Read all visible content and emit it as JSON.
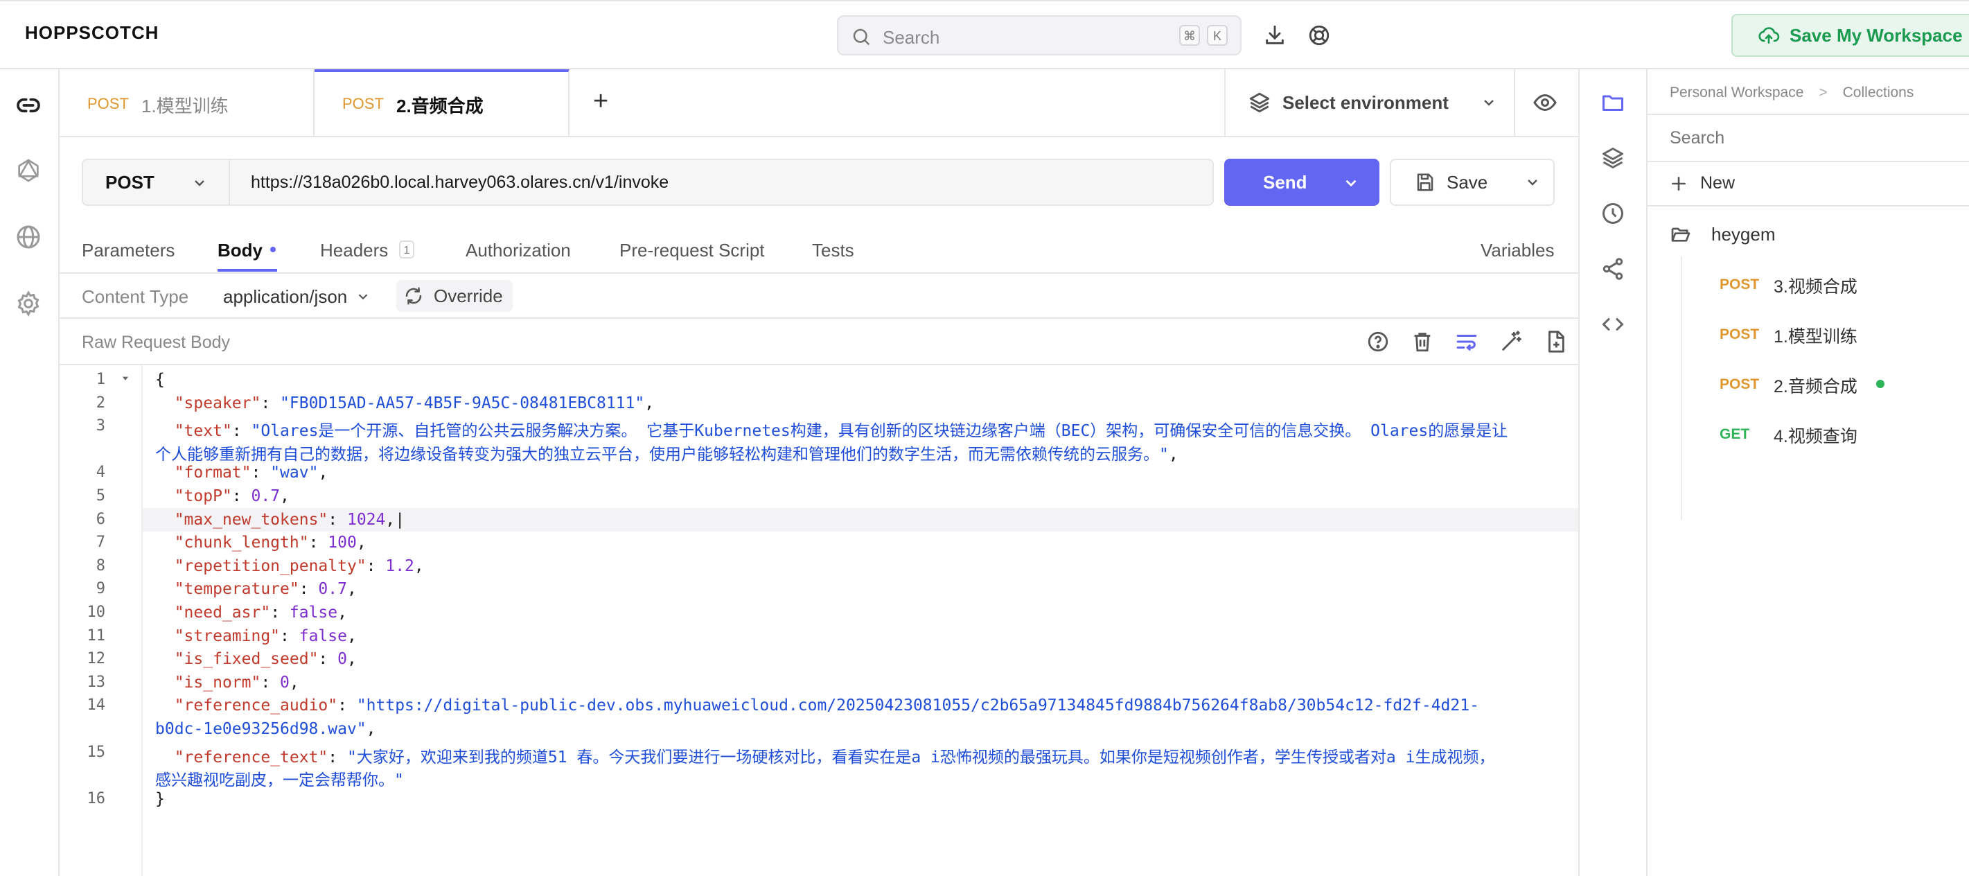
{
  "app": {
    "brand": "HOPPSCOTCH"
  },
  "header": {
    "search_placeholder": "Search",
    "shortcut_key1": "⌘",
    "shortcut_key2": "K",
    "save_workspace_label": "Save My Workspace"
  },
  "tabs": [
    {
      "method": "POST",
      "title": "1.模型训练"
    },
    {
      "method": "POST",
      "title": "2.音频合成"
    }
  ],
  "add_tab_label": "+",
  "environment": {
    "label": "Select environment"
  },
  "request": {
    "method": "POST",
    "url": "https://318a026b0.local.harvey063.olares.cn/v1/invoke",
    "send_label": "Send",
    "save_label": "Save"
  },
  "subtabs": {
    "parameters": "Parameters",
    "body": "Body",
    "headers": "Headers",
    "headers_count": "1",
    "authorization": "Authorization",
    "prerequest": "Pre-request Script",
    "tests": "Tests",
    "variables": "Variables"
  },
  "content_type": {
    "label": "Content Type",
    "value": "application/json",
    "override_label": "Override"
  },
  "raw_body_label": "Raw Request Body",
  "body_lines": [
    {
      "n": "1",
      "parts": [
        [
          "p",
          "{"
        ]
      ]
    },
    {
      "n": "2",
      "parts": [
        [
          "p",
          "  "
        ],
        [
          "k",
          "\"speaker\""
        ],
        [
          "p",
          ": "
        ],
        [
          "s",
          "\"FB0D15AD-AA57-4B5F-9A5C-08481EBC8111\""
        ],
        [
          "p",
          ","
        ]
      ]
    },
    {
      "n": "3",
      "parts": [
        [
          "p",
          "  "
        ],
        [
          "k",
          "\"text\""
        ],
        [
          "p",
          ": "
        ],
        [
          "s",
          "\"Olares是一个开源、自托管的公共云服务解决方案。 它基于Kubernetes构建，具有创新的区块链边缘客户端（BEC）架构，可确保安全可信的信息交换。 Olares的愿景是让"
        ]
      ]
    },
    {
      "n": "",
      "parts": [
        [
          "s",
          "个人能够重新拥有自己的数据，将边缘设备转变为强大的独立云平台，使用户能够轻松构建和管理他们的数字生活，而无需依赖传统的云服务。\""
        ],
        [
          "p",
          ","
        ]
      ]
    },
    {
      "n": "4",
      "parts": [
        [
          "p",
          "  "
        ],
        [
          "k",
          "\"format\""
        ],
        [
          "p",
          ": "
        ],
        [
          "s",
          "\"wav\""
        ],
        [
          "p",
          ","
        ]
      ]
    },
    {
      "n": "5",
      "parts": [
        [
          "p",
          "  "
        ],
        [
          "k",
          "\"topP\""
        ],
        [
          "p",
          ": "
        ],
        [
          "n",
          "0.7"
        ],
        [
          "p",
          ","
        ]
      ]
    },
    {
      "n": "6",
      "parts": [
        [
          "p",
          "  "
        ],
        [
          "k",
          "\"max_new_tokens\""
        ],
        [
          "p",
          ": "
        ],
        [
          "n",
          "1024"
        ],
        [
          "p",
          ",|"
        ]
      ]
    },
    {
      "n": "7",
      "parts": [
        [
          "p",
          "  "
        ],
        [
          "k",
          "\"chunk_length\""
        ],
        [
          "p",
          ": "
        ],
        [
          "n",
          "100"
        ],
        [
          "p",
          ","
        ]
      ]
    },
    {
      "n": "8",
      "parts": [
        [
          "p",
          "  "
        ],
        [
          "k",
          "\"repetition_penalty\""
        ],
        [
          "p",
          ": "
        ],
        [
          "n",
          "1.2"
        ],
        [
          "p",
          ","
        ]
      ]
    },
    {
      "n": "9",
      "parts": [
        [
          "p",
          "  "
        ],
        [
          "k",
          "\"temperature\""
        ],
        [
          "p",
          ": "
        ],
        [
          "n",
          "0.7"
        ],
        [
          "p",
          ","
        ]
      ]
    },
    {
      "n": "10",
      "parts": [
        [
          "p",
          "  "
        ],
        [
          "k",
          "\"need_asr\""
        ],
        [
          "p",
          ": "
        ],
        [
          "n",
          "false"
        ],
        [
          "p",
          ","
        ]
      ]
    },
    {
      "n": "11",
      "parts": [
        [
          "p",
          "  "
        ],
        [
          "k",
          "\"streaming\""
        ],
        [
          "p",
          ": "
        ],
        [
          "n",
          "false"
        ],
        [
          "p",
          ","
        ]
      ]
    },
    {
      "n": "12",
      "parts": [
        [
          "p",
          "  "
        ],
        [
          "k",
          "\"is_fixed_seed\""
        ],
        [
          "p",
          ": "
        ],
        [
          "n",
          "0"
        ],
        [
          "p",
          ","
        ]
      ]
    },
    {
      "n": "13",
      "parts": [
        [
          "p",
          "  "
        ],
        [
          "k",
          "\"is_norm\""
        ],
        [
          "p",
          ": "
        ],
        [
          "n",
          "0"
        ],
        [
          "p",
          ","
        ]
      ]
    },
    {
      "n": "14",
      "parts": [
        [
          "p",
          "  "
        ],
        [
          "k",
          "\"reference_audio\""
        ],
        [
          "p",
          ": "
        ],
        [
          "s",
          "\"https://digital-public-dev.obs.myhuaweicloud.com/20250423081055/c2b65a97134845fd9884b756264f8ab8/30b54c12-fd2f-4d21-"
        ]
      ]
    },
    {
      "n": "",
      "parts": [
        [
          "s",
          "b0dc-1e0e93256d98.wav\""
        ],
        [
          "p",
          ","
        ]
      ]
    },
    {
      "n": "15",
      "parts": [
        [
          "p",
          "  "
        ],
        [
          "k",
          "\"reference_text\""
        ],
        [
          "p",
          ": "
        ],
        [
          "s",
          "\"大家好，欢迎来到我的频道51 春。今天我们要进行一场硬核对比，看看实在是a i恐怖视频的最强玩具。如果你是短视频创作者，学生传授或者对a i生成视频，"
        ]
      ]
    },
    {
      "n": "",
      "parts": [
        [
          "s",
          "感兴趣视吃副皮，一定会帮帮你。\""
        ]
      ]
    },
    {
      "n": "16",
      "parts": [
        [
          "p",
          "}"
        ]
      ]
    }
  ],
  "collections": {
    "breadcrumb_root": "Personal Workspace",
    "breadcrumb_sep": ">",
    "breadcrumb_current": "Collections",
    "search_placeholder": "Search",
    "new_label": "New",
    "folder_name": "heygem",
    "items": [
      {
        "method": "POST",
        "title": "3.视频合成"
      },
      {
        "method": "POST",
        "title": "1.模型训练"
      },
      {
        "method": "POST",
        "title": "2.音频合成"
      },
      {
        "method": "GET",
        "title": "4.视频查询"
      }
    ]
  },
  "colors": {
    "accent": "#6366f1",
    "post": "#e0962d",
    "get": "#2fb45a",
    "active_dot": "#2fb45a"
  }
}
